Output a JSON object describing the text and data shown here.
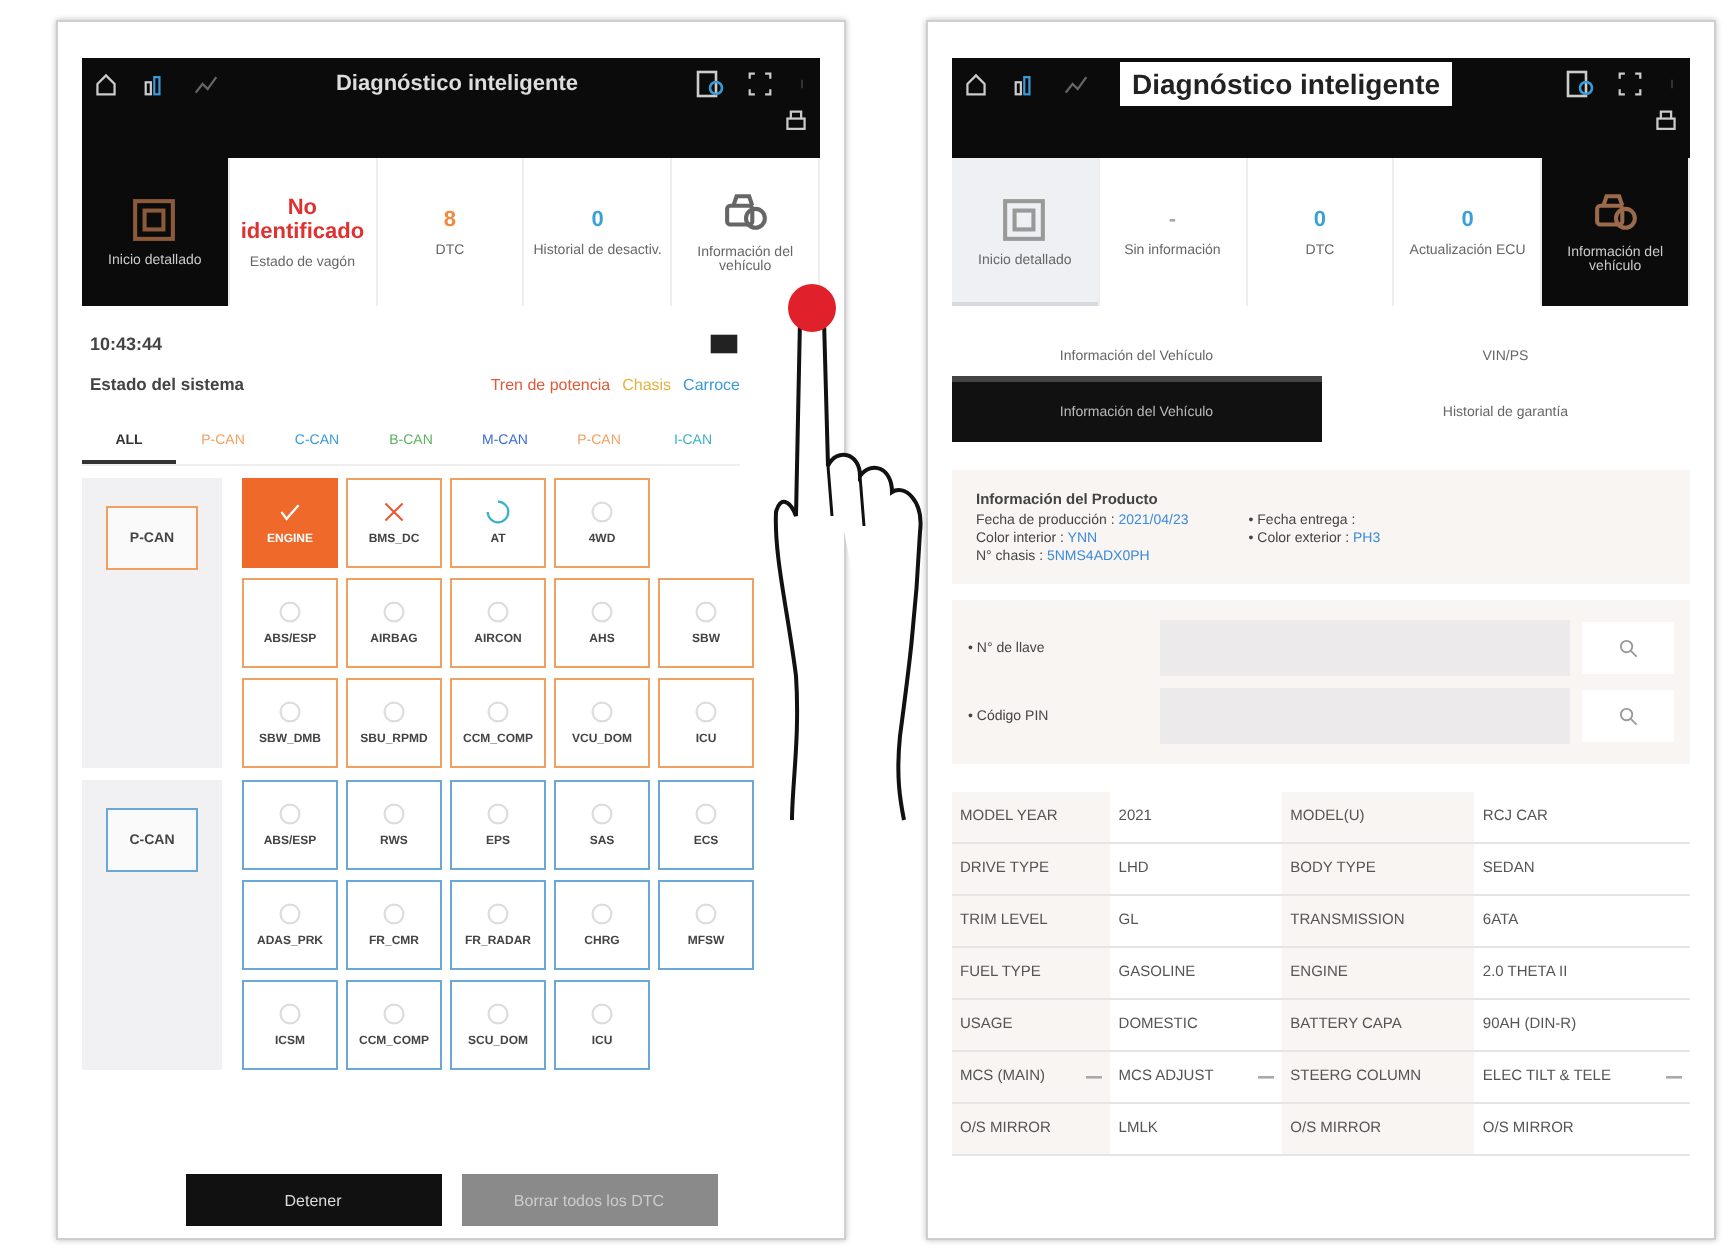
{
  "left_screen": {
    "title": "Diagnóstico inteligente",
    "tiles": [
      {
        "kind": "icon",
        "label": "Inicio detallado",
        "selected": true,
        "highlighted": false
      },
      {
        "kind": "value",
        "value": "No identificado",
        "label": "Estado de vagón",
        "color": "#e03030",
        "selected": false,
        "highlighted": false
      },
      {
        "kind": "value",
        "value": "8",
        "label": "DTC",
        "color": "#f08a3c",
        "selected": false,
        "highlighted": false
      },
      {
        "kind": "value",
        "value": "0",
        "label": "Historial de desactiv.",
        "color": "#3aa0d8",
        "selected": false,
        "highlighted": false
      },
      {
        "kind": "car",
        "label": "Información del vehículo",
        "selected": false,
        "highlighted": false
      }
    ],
    "time": "10:43:44",
    "status_title": "Estado del sistema",
    "legend": [
      {
        "label": "Tren de potencia",
        "color": "#e05a3a"
      },
      {
        "label": "Chasis",
        "color": "#e8b040"
      },
      {
        "label": "Carroce",
        "color": "#3a9ad8"
      }
    ],
    "tabs": [
      {
        "label": "ALL",
        "selected": true,
        "color": "#333333"
      },
      {
        "label": "P-CAN",
        "selected": false,
        "color": "#f0a060"
      },
      {
        "label": "C-CAN",
        "selected": false,
        "color": "#3a9ad8"
      },
      {
        "label": "B-CAN",
        "selected": false,
        "color": "#60b060"
      },
      {
        "label": "M-CAN",
        "selected": false,
        "color": "#3a6ad8"
      },
      {
        "label": "P-CAN",
        "selected": false,
        "color": "#f0a060"
      },
      {
        "label": "I-CAN",
        "selected": false,
        "color": "#3ab0c8"
      }
    ],
    "buses": [
      {
        "name": "P-CAN",
        "color": "#f0a060",
        "rows": [
          [
            {
              "name": "ENGINE",
              "kind": "ok",
              "selected": true
            },
            {
              "name": "BMS_DC",
              "kind": "error",
              "selected": false
            },
            {
              "name": "AT",
              "kind": "loading",
              "selected": false
            },
            {
              "name": "4WD",
              "kind": "idle",
              "selected": false
            }
          ],
          [
            {
              "name": "ABS/ESP",
              "kind": "idle",
              "selected": false
            },
            {
              "name": "AIRBAG",
              "kind": "idle",
              "selected": false
            },
            {
              "name": "AIRCON",
              "kind": "idle",
              "selected": false
            },
            {
              "name": "AHS",
              "kind": "idle",
              "selected": false
            },
            {
              "name": "SBW",
              "kind": "idle",
              "selected": false
            }
          ],
          [
            {
              "name": "SBW_DMB",
              "kind": "idle",
              "selected": false
            },
            {
              "name": "SBU_RPMD",
              "kind": "idle",
              "selected": false
            },
            {
              "name": "CCM_COMP",
              "kind": "idle",
              "selected": false
            },
            {
              "name": "VCU_DOM",
              "kind": "idle",
              "selected": false
            },
            {
              "name": "ICU",
              "kind": "idle",
              "selected": false
            }
          ]
        ]
      },
      {
        "name": "C-CAN",
        "color": "#6aa8d8",
        "rows": [
          [
            {
              "name": "ABS/ESP",
              "kind": "idle",
              "selected": false
            },
            {
              "name": "RWS",
              "kind": "idle",
              "selected": false
            },
            {
              "name": "EPS",
              "kind": "idle",
              "selected": false
            },
            {
              "name": "SAS",
              "kind": "idle",
              "selected": false
            },
            {
              "name": "ECS",
              "kind": "idle",
              "selected": false
            }
          ],
          [
            {
              "name": "ADAS_PRK",
              "kind": "idle",
              "selected": false
            },
            {
              "name": "FR_CMR",
              "kind": "idle",
              "selected": false
            },
            {
              "name": "FR_RADAR",
              "kind": "idle",
              "selected": false
            },
            {
              "name": "CHRG",
              "kind": "idle",
              "selected": false
            },
            {
              "name": "MFSW",
              "kind": "idle",
              "selected": false
            }
          ],
          [
            {
              "name": "ICSM",
              "kind": "idle",
              "selected": false
            },
            {
              "name": "CCM_COMP",
              "kind": "idle",
              "selected": false
            },
            {
              "name": "SCU_DOM",
              "kind": "idle",
              "selected": false
            },
            {
              "name": "ICU",
              "kind": "idle",
              "selected": false
            }
          ]
        ]
      }
    ],
    "buttons": [
      {
        "label": "Detener",
        "disabled": false
      },
      {
        "label": "Borrar todos los DTC",
        "disabled": true
      }
    ]
  },
  "right_screen": {
    "title": "Diagnóstico inteligente",
    "tiles": [
      {
        "kind": "icon",
        "label": "Inicio detallado",
        "selected": false,
        "highlighted": true
      },
      {
        "kind": "value",
        "value": "-",
        "label": "Sin información",
        "color": "#aaaaaa",
        "selected": false,
        "highlighted": false
      },
      {
        "kind": "value",
        "value": "0",
        "label": "DTC",
        "color": "#3aa0d8",
        "selected": false,
        "highlighted": false
      },
      {
        "kind": "value",
        "value": "0",
        "label": "Actualización ECU",
        "color": "#3aa0d8",
        "selected": false,
        "highlighted": false
      },
      {
        "kind": "car",
        "label": "Información del vehículo",
        "selected": true,
        "highlighted": false
      }
    ],
    "tabs": [
      {
        "label": "Información del Vehículo",
        "selected": true
      },
      {
        "label": "VIN/PS",
        "selected": false
      }
    ],
    "subtabs": [
      {
        "label": "Información del Vehículo",
        "selected": true
      },
      {
        "label": "Historial de garantía",
        "selected": false
      }
    ],
    "product": {
      "title": "Información del Producto",
      "left_lines": [
        {
          "label": "Fecha de producción : ",
          "value": "2021/04/23"
        },
        {
          "label": "Color interior : ",
          "value": "YNN"
        },
        {
          "label": "N° chasis : ",
          "value": "5NMS4ADX0PH"
        }
      ],
      "right_lines": [
        {
          "label": "• Fecha entrega : "
        },
        {
          "label": "• Color exterior : ",
          "value": "PH3"
        }
      ]
    },
    "search_fields": [
      {
        "label": "• N° de llave"
      },
      {
        "label": "• Código PIN"
      }
    ],
    "table": [
      [
        {
          "text": "MODEL YEAR"
        },
        {
          "text": "2021"
        },
        {
          "text": "MODEL(U)"
        },
        {
          "text": "RCJ CAR"
        }
      ],
      [
        {
          "text": "DRIVE TYPE"
        },
        {
          "text": "LHD"
        },
        {
          "text": "BODY TYPE"
        },
        {
          "text": "SEDAN"
        }
      ],
      [
        {
          "text": "TRIM LEVEL"
        },
        {
          "text": "GL"
        },
        {
          "text": "TRANSMISSION"
        },
        {
          "text": "6ATA"
        }
      ],
      [
        {
          "text": "FUEL TYPE"
        },
        {
          "text": "GASOLINE"
        },
        {
          "text": "ENGINE"
        },
        {
          "text": "2.0 THETA II"
        }
      ],
      [
        {
          "text": "USAGE"
        },
        {
          "text": "DOMESTIC"
        },
        {
          "text": "BATTERY CAPA"
        },
        {
          "text": "90AH (DIN-R)"
        }
      ],
      [
        {
          "text": "MCS (MAIN)",
          "dropdown": true
        },
        {
          "text": "MCS ADJUST",
          "dropdown": true
        },
        {
          "text": "STEERG COLUMN"
        },
        {
          "text": "ELEC TILT & TELE",
          "dropdown": true
        }
      ],
      [
        {
          "text": "O/S MIRROR"
        },
        {
          "text": "LMLK"
        },
        {
          "text": "O/S MIRROR"
        },
        {
          "text": "O/S MIRROR"
        }
      ]
    ]
  }
}
